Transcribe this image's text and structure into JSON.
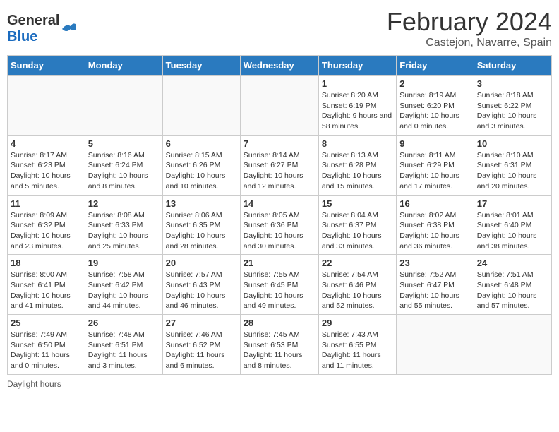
{
  "logo": {
    "text_general": "General",
    "text_blue": "Blue"
  },
  "title": "February 2024",
  "subtitle": "Castejon, Navarre, Spain",
  "days_of_week": [
    "Sunday",
    "Monday",
    "Tuesday",
    "Wednesday",
    "Thursday",
    "Friday",
    "Saturday"
  ],
  "weeks": [
    [
      {
        "day": "",
        "sunrise": "",
        "sunset": "",
        "daylight": "",
        "empty": true
      },
      {
        "day": "",
        "sunrise": "",
        "sunset": "",
        "daylight": "",
        "empty": true
      },
      {
        "day": "",
        "sunrise": "",
        "sunset": "",
        "daylight": "",
        "empty": true
      },
      {
        "day": "",
        "sunrise": "",
        "sunset": "",
        "daylight": "",
        "empty": true
      },
      {
        "day": "1",
        "sunrise": "Sunrise: 8:20 AM",
        "sunset": "Sunset: 6:19 PM",
        "daylight": "Daylight: 9 hours and 58 minutes.",
        "empty": false
      },
      {
        "day": "2",
        "sunrise": "Sunrise: 8:19 AM",
        "sunset": "Sunset: 6:20 PM",
        "daylight": "Daylight: 10 hours and 0 minutes.",
        "empty": false
      },
      {
        "day": "3",
        "sunrise": "Sunrise: 8:18 AM",
        "sunset": "Sunset: 6:22 PM",
        "daylight": "Daylight: 10 hours and 3 minutes.",
        "empty": false
      }
    ],
    [
      {
        "day": "4",
        "sunrise": "Sunrise: 8:17 AM",
        "sunset": "Sunset: 6:23 PM",
        "daylight": "Daylight: 10 hours and 5 minutes.",
        "empty": false
      },
      {
        "day": "5",
        "sunrise": "Sunrise: 8:16 AM",
        "sunset": "Sunset: 6:24 PM",
        "daylight": "Daylight: 10 hours and 8 minutes.",
        "empty": false
      },
      {
        "day": "6",
        "sunrise": "Sunrise: 8:15 AM",
        "sunset": "Sunset: 6:26 PM",
        "daylight": "Daylight: 10 hours and 10 minutes.",
        "empty": false
      },
      {
        "day": "7",
        "sunrise": "Sunrise: 8:14 AM",
        "sunset": "Sunset: 6:27 PM",
        "daylight": "Daylight: 10 hours and 12 minutes.",
        "empty": false
      },
      {
        "day": "8",
        "sunrise": "Sunrise: 8:13 AM",
        "sunset": "Sunset: 6:28 PM",
        "daylight": "Daylight: 10 hours and 15 minutes.",
        "empty": false
      },
      {
        "day": "9",
        "sunrise": "Sunrise: 8:11 AM",
        "sunset": "Sunset: 6:29 PM",
        "daylight": "Daylight: 10 hours and 17 minutes.",
        "empty": false
      },
      {
        "day": "10",
        "sunrise": "Sunrise: 8:10 AM",
        "sunset": "Sunset: 6:31 PM",
        "daylight": "Daylight: 10 hours and 20 minutes.",
        "empty": false
      }
    ],
    [
      {
        "day": "11",
        "sunrise": "Sunrise: 8:09 AM",
        "sunset": "Sunset: 6:32 PM",
        "daylight": "Daylight: 10 hours and 23 minutes.",
        "empty": false
      },
      {
        "day": "12",
        "sunrise": "Sunrise: 8:08 AM",
        "sunset": "Sunset: 6:33 PM",
        "daylight": "Daylight: 10 hours and 25 minutes.",
        "empty": false
      },
      {
        "day": "13",
        "sunrise": "Sunrise: 8:06 AM",
        "sunset": "Sunset: 6:35 PM",
        "daylight": "Daylight: 10 hours and 28 minutes.",
        "empty": false
      },
      {
        "day": "14",
        "sunrise": "Sunrise: 8:05 AM",
        "sunset": "Sunset: 6:36 PM",
        "daylight": "Daylight: 10 hours and 30 minutes.",
        "empty": false
      },
      {
        "day": "15",
        "sunrise": "Sunrise: 8:04 AM",
        "sunset": "Sunset: 6:37 PM",
        "daylight": "Daylight: 10 hours and 33 minutes.",
        "empty": false
      },
      {
        "day": "16",
        "sunrise": "Sunrise: 8:02 AM",
        "sunset": "Sunset: 6:38 PM",
        "daylight": "Daylight: 10 hours and 36 minutes.",
        "empty": false
      },
      {
        "day": "17",
        "sunrise": "Sunrise: 8:01 AM",
        "sunset": "Sunset: 6:40 PM",
        "daylight": "Daylight: 10 hours and 38 minutes.",
        "empty": false
      }
    ],
    [
      {
        "day": "18",
        "sunrise": "Sunrise: 8:00 AM",
        "sunset": "Sunset: 6:41 PM",
        "daylight": "Daylight: 10 hours and 41 minutes.",
        "empty": false
      },
      {
        "day": "19",
        "sunrise": "Sunrise: 7:58 AM",
        "sunset": "Sunset: 6:42 PM",
        "daylight": "Daylight: 10 hours and 44 minutes.",
        "empty": false
      },
      {
        "day": "20",
        "sunrise": "Sunrise: 7:57 AM",
        "sunset": "Sunset: 6:43 PM",
        "daylight": "Daylight: 10 hours and 46 minutes.",
        "empty": false
      },
      {
        "day": "21",
        "sunrise": "Sunrise: 7:55 AM",
        "sunset": "Sunset: 6:45 PM",
        "daylight": "Daylight: 10 hours and 49 minutes.",
        "empty": false
      },
      {
        "day": "22",
        "sunrise": "Sunrise: 7:54 AM",
        "sunset": "Sunset: 6:46 PM",
        "daylight": "Daylight: 10 hours and 52 minutes.",
        "empty": false
      },
      {
        "day": "23",
        "sunrise": "Sunrise: 7:52 AM",
        "sunset": "Sunset: 6:47 PM",
        "daylight": "Daylight: 10 hours and 55 minutes.",
        "empty": false
      },
      {
        "day": "24",
        "sunrise": "Sunrise: 7:51 AM",
        "sunset": "Sunset: 6:48 PM",
        "daylight": "Daylight: 10 hours and 57 minutes.",
        "empty": false
      }
    ],
    [
      {
        "day": "25",
        "sunrise": "Sunrise: 7:49 AM",
        "sunset": "Sunset: 6:50 PM",
        "daylight": "Daylight: 11 hours and 0 minutes.",
        "empty": false
      },
      {
        "day": "26",
        "sunrise": "Sunrise: 7:48 AM",
        "sunset": "Sunset: 6:51 PM",
        "daylight": "Daylight: 11 hours and 3 minutes.",
        "empty": false
      },
      {
        "day": "27",
        "sunrise": "Sunrise: 7:46 AM",
        "sunset": "Sunset: 6:52 PM",
        "daylight": "Daylight: 11 hours and 6 minutes.",
        "empty": false
      },
      {
        "day": "28",
        "sunrise": "Sunrise: 7:45 AM",
        "sunset": "Sunset: 6:53 PM",
        "daylight": "Daylight: 11 hours and 8 minutes.",
        "empty": false
      },
      {
        "day": "29",
        "sunrise": "Sunrise: 7:43 AM",
        "sunset": "Sunset: 6:55 PM",
        "daylight": "Daylight: 11 hours and 11 minutes.",
        "empty": false
      },
      {
        "day": "",
        "sunrise": "",
        "sunset": "",
        "daylight": "",
        "empty": true
      },
      {
        "day": "",
        "sunrise": "",
        "sunset": "",
        "daylight": "",
        "empty": true
      }
    ]
  ],
  "footer": "Daylight hours"
}
